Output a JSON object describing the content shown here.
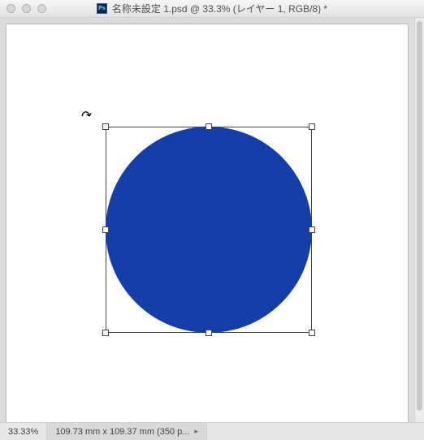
{
  "app_badge": "Ps",
  "title": "名称未設定 1.psd @ 33.3% (レイヤー 1, RGB/8) *",
  "status": {
    "zoom": "33.33%",
    "doc": "109.73 mm x 109.37 mm (350 p...",
    "chevron": "▸"
  },
  "colors": {
    "shape_fill": "#143ea8"
  }
}
